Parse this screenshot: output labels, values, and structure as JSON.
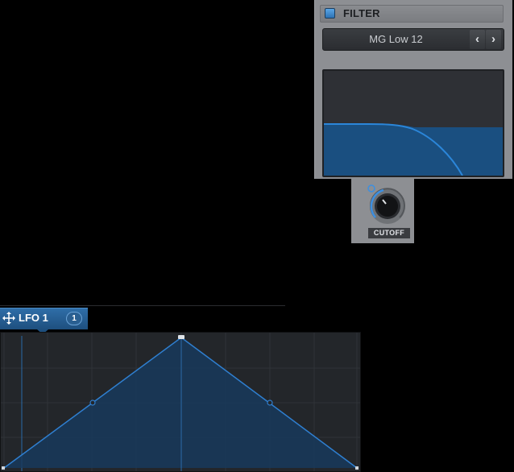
{
  "filter": {
    "title": "FILTER",
    "enabled": true,
    "type_label": "MG Low 12",
    "prev_glyph": "‹",
    "next_glyph": "›",
    "curve_color": "#1e6fb7",
    "fill_color": "#1a4f80"
  },
  "cutoff": {
    "label": "CUTOFF",
    "value": 0.38,
    "accent": "#3d8fe0"
  },
  "lfo": {
    "title": "LFO 1",
    "badge": "1",
    "shape": "triangle",
    "line_color": "#2f7fd0"
  }
}
